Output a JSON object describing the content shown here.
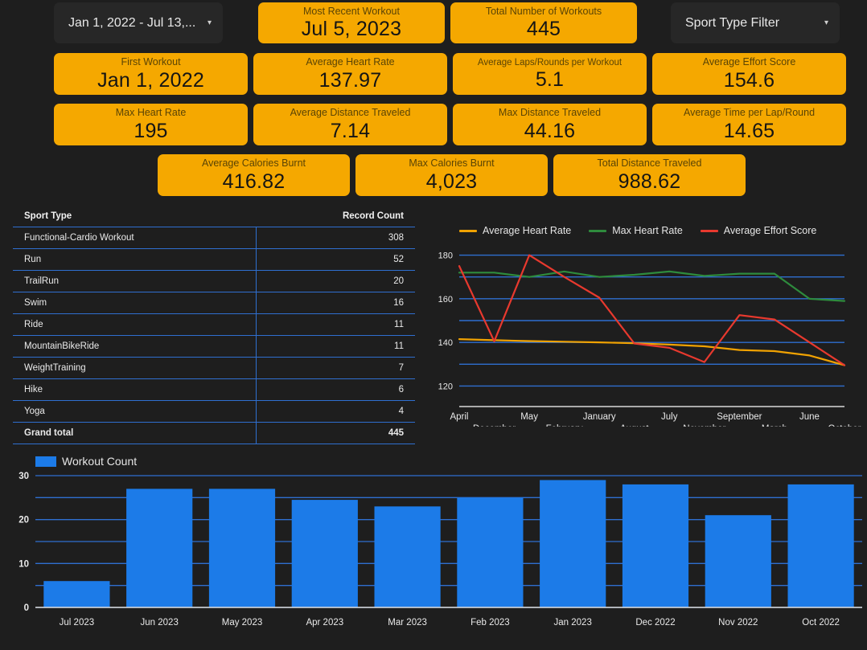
{
  "filters": {
    "date_range": {
      "label": "Jan 1, 2022 - Jul 13,...",
      "caret": "chevron-down-icon"
    },
    "sport_type": {
      "label": "Sport Type Filter",
      "caret": "chevron-down-icon"
    }
  },
  "colors": {
    "background": "#1e1e1e",
    "kpi_card": "#F5A800",
    "bar_blue": "#1C7BE8",
    "gridline_blue": "#2f6fd0",
    "avg_heart_rate": "#F0A202",
    "max_heart_rate": "#2E8B3D",
    "avg_effort_score": "#E8392E"
  },
  "kpis": [
    {
      "label": "Most Recent Workout",
      "value": "Jul 5, 2023"
    },
    {
      "label": "Total Number of Workouts",
      "value": "445"
    },
    {
      "label": "First Workout",
      "value": "Jan 1, 2022"
    },
    {
      "label": "Average Heart Rate",
      "value": "137.97"
    },
    {
      "label": "Average Laps/Rounds per Workout",
      "value": "5.1"
    },
    {
      "label": "Average Effort Score",
      "value": "154.6"
    },
    {
      "label": "Max Heart Rate",
      "value": "195"
    },
    {
      "label": "Average Distance Traveled",
      "value": "7.14"
    },
    {
      "label": "Max Distance Traveled",
      "value": "44.16"
    },
    {
      "label": "Average Time per Lap/Round",
      "value": "14.65"
    },
    {
      "label": "Average Calories Burnt",
      "value": "416.82"
    },
    {
      "label": "Max Calories Burnt",
      "value": "4,023"
    },
    {
      "label": "Total Distance Traveled",
      "value": "988.62"
    }
  ],
  "sport_table": {
    "columns": [
      "Sport Type",
      "Record Count"
    ],
    "rows": [
      {
        "sport": "Functional-Cardio Workout",
        "count": "308"
      },
      {
        "sport": "Run",
        "count": "52"
      },
      {
        "sport": "TrailRun",
        "count": "20"
      },
      {
        "sport": "Swim",
        "count": "16"
      },
      {
        "sport": "Ride",
        "count": "11"
      },
      {
        "sport": "MountainBikeRide",
        "count": "11"
      },
      {
        "sport": "WeightTraining",
        "count": "7"
      },
      {
        "sport": "Hike",
        "count": "6"
      },
      {
        "sport": "Yoga",
        "count": "4"
      }
    ],
    "total_row": {
      "sport": "Grand total",
      "count": "445"
    }
  },
  "chart_data": [
    {
      "type": "line",
      "title": "",
      "xlabel": "",
      "ylabel": "",
      "grid": true,
      "legend_position": "top",
      "ylim": [
        115,
        185
      ],
      "yticks": [
        120,
        140,
        160,
        180
      ],
      "ytick_labels": [
        "120",
        "140",
        "160",
        "180"
      ],
      "minor_gridlines": [
        130,
        150,
        170
      ],
      "categories": [
        "April",
        "December",
        "May",
        "February",
        "January",
        "August",
        "July",
        "November",
        "September",
        "March",
        "June",
        "October"
      ],
      "series": [
        {
          "name": "Average Heart Rate",
          "color": "#F0A202",
          "values": [
            141.5,
            141.0,
            140.6,
            140.3,
            140.0,
            139.6,
            139.0,
            138.2,
            136.5,
            136.0,
            134.0,
            129.5
          ]
        },
        {
          "name": "Max Heart Rate",
          "color": "#2E8B3D",
          "values": [
            172.0,
            172.0,
            170.0,
            172.5,
            170.0,
            171.0,
            172.5,
            170.5,
            171.5,
            171.5,
            160.0,
            159.0
          ]
        },
        {
          "name": "Average Effort Score",
          "color": "#E8392E",
          "values": [
            175.0,
            140.5,
            180.0,
            170.0,
            160.5,
            139.5,
            137.5,
            131.0,
            152.5,
            150.5,
            140.0,
            129.5
          ]
        }
      ]
    },
    {
      "type": "bar",
      "title": "",
      "xlabel": "",
      "ylabel": "",
      "grid": true,
      "legend_position": "top",
      "ylim": [
        0,
        30
      ],
      "yticks": [
        0,
        10,
        20,
        30
      ],
      "ytick_labels": [
        "0",
        "10",
        "20",
        "30"
      ],
      "minor_gridlines": [
        5,
        15,
        25
      ],
      "series_name": "Workout Count",
      "color": "#1C7BE8",
      "categories": [
        "Jul 2023",
        "Jun 2023",
        "May 2023",
        "Apr 2023",
        "Mar 2023",
        "Feb 2023",
        "Jan 2023",
        "Dec 2022",
        "Nov 2022",
        "Oct 2022"
      ],
      "values": [
        6,
        27,
        27,
        24.5,
        23,
        25,
        29,
        28,
        21,
        28
      ]
    }
  ]
}
